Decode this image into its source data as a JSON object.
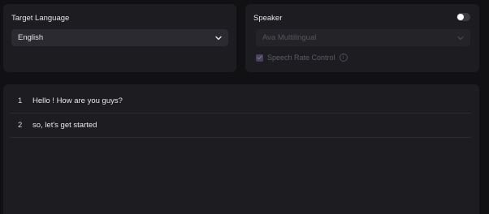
{
  "target_language": {
    "label": "Target Language",
    "selected": "English"
  },
  "speaker": {
    "label": "Speaker",
    "enabled": false,
    "voice_selected": "Ava Multilingual",
    "speech_rate_label": "Speech Rate Control",
    "speech_rate_checked": true
  },
  "transcript": {
    "rows": [
      {
        "index": "1",
        "text": "Hello ! How are you guys?"
      },
      {
        "index": "2",
        "text": "so, let's get started"
      }
    ]
  }
}
